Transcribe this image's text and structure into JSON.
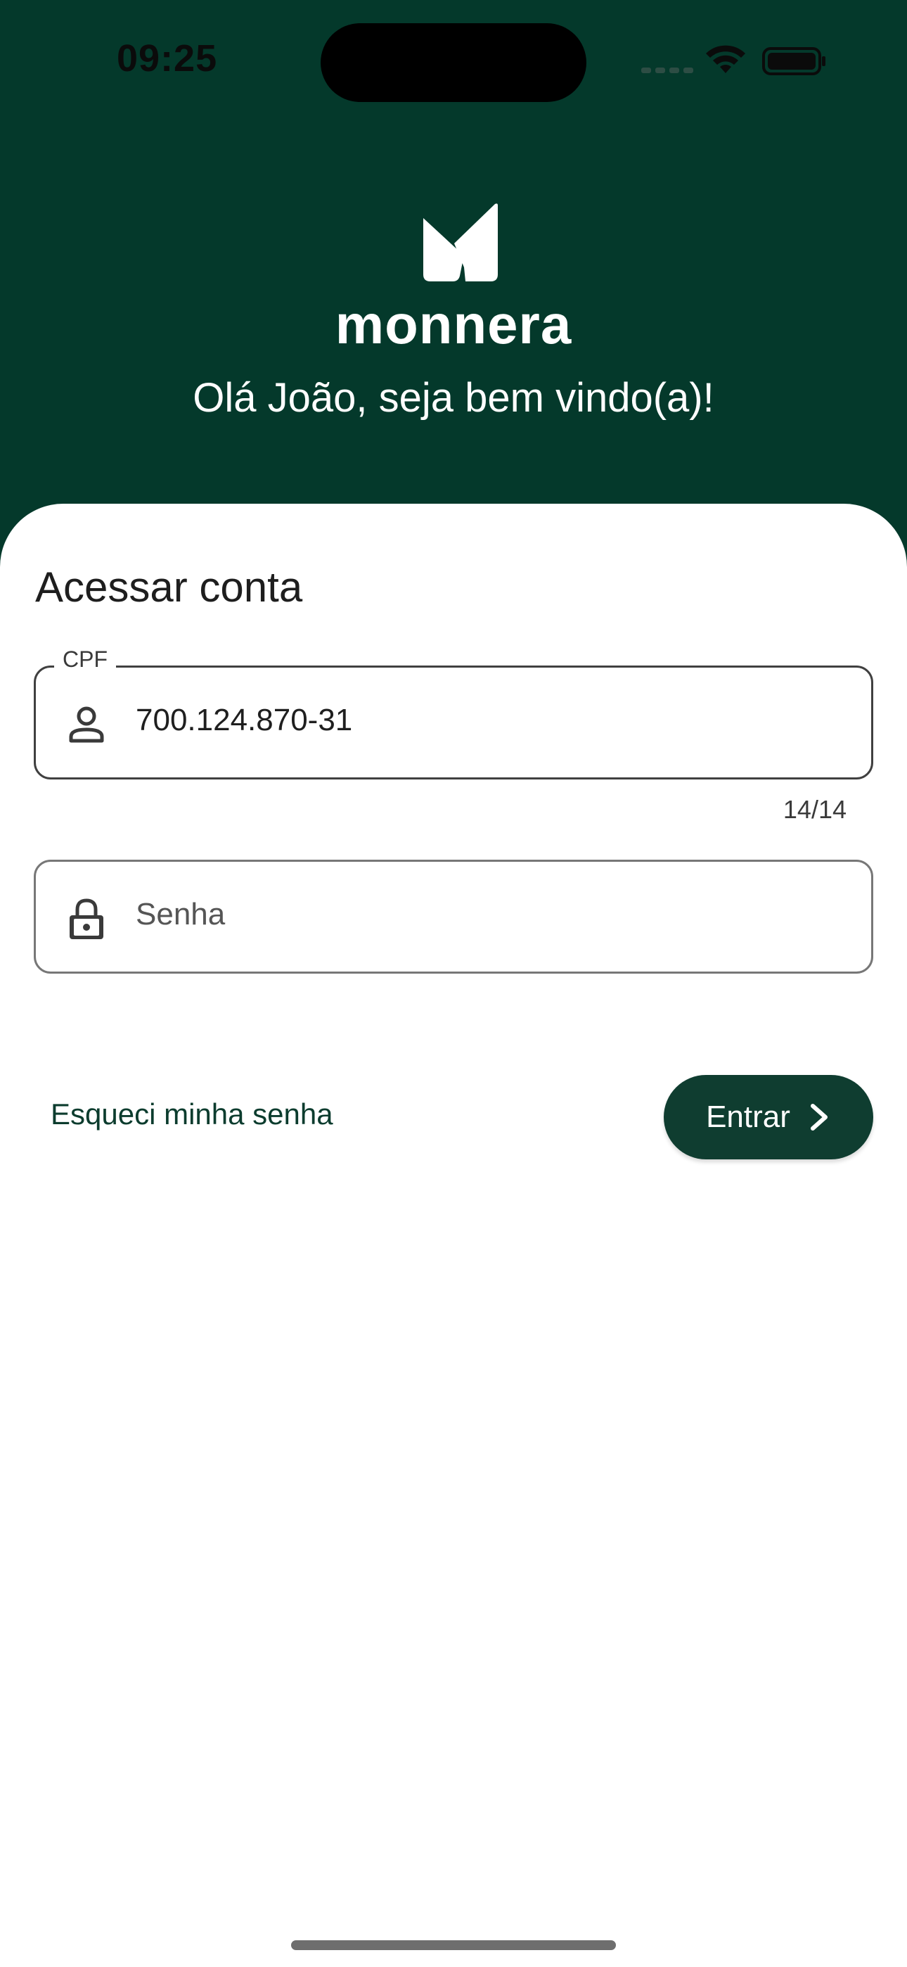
{
  "status_bar": {
    "time": "09:25",
    "icons": [
      "cellular-signal-icon",
      "wifi-icon",
      "battery-icon"
    ]
  },
  "header": {
    "logo_text": "monnera",
    "greeting": "Olá João, seja bem vindo(a)!"
  },
  "login": {
    "title": "Acessar conta",
    "cpf": {
      "label": "CPF",
      "value": "700.124.870-31",
      "counter": "14/14",
      "icon": "person-icon"
    },
    "password": {
      "placeholder": "Senha",
      "value": "",
      "icon": "lock-icon"
    },
    "forgot_password": "Esqueci minha senha",
    "submit_label": "Entrar",
    "submit_icon": "chevron-right-icon"
  },
  "colors": {
    "header_bg": "#04392b",
    "primary_button": "#0f3d30",
    "link": "#0c3c2e"
  }
}
